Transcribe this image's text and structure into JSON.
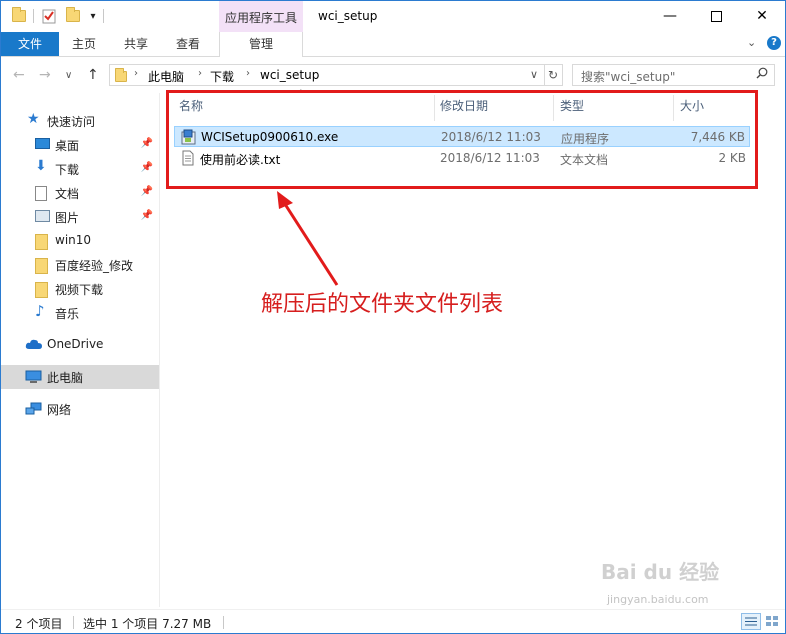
{
  "window": {
    "title": "wci_setup",
    "context_tab_label": "应用程序工具"
  },
  "ribbon": {
    "tabs": [
      {
        "label": "文件"
      },
      {
        "label": "主页"
      },
      {
        "label": "共享"
      },
      {
        "label": "查看"
      },
      {
        "label": "管理"
      }
    ]
  },
  "address": {
    "breadcrumb": [
      "此电脑",
      "下载",
      "wci_setup"
    ],
    "search_placeholder": "搜索\"wci_setup\""
  },
  "sidebar": {
    "quick_access_label": "快速访问",
    "items": [
      {
        "label": "桌面",
        "pinned": true
      },
      {
        "label": "下载",
        "pinned": true
      },
      {
        "label": "文档",
        "pinned": true
      },
      {
        "label": "图片",
        "pinned": true
      },
      {
        "label": "win10",
        "pinned": false
      },
      {
        "label": "百度经验_修改",
        "pinned": false
      },
      {
        "label": "视频下载",
        "pinned": false
      },
      {
        "label": "音乐",
        "pinned": false
      }
    ],
    "onedrive_label": "OneDrive",
    "thispc_label": "此电脑",
    "network_label": "网络"
  },
  "filelist": {
    "columns": [
      "名称",
      "修改日期",
      "类型",
      "大小"
    ],
    "rows": [
      {
        "name": "WCISetup0900610.exe",
        "date": "2018/6/12 11:03",
        "type": "应用程序",
        "size": "7,446 KB",
        "selected": true
      },
      {
        "name": "使用前必读.txt",
        "date": "2018/6/12 11:03",
        "type": "文本文档",
        "size": "2 KB",
        "selected": false
      }
    ]
  },
  "annotation": {
    "text": "解压后的文件夹文件列表",
    "color": "#e21b1b"
  },
  "status": {
    "item_count": "2 个项目",
    "selection": "选中 1 个项目  7.27 MB"
  },
  "watermark": {
    "text": "Bai du 经验",
    "sub": "jingyan.baidu.com"
  }
}
